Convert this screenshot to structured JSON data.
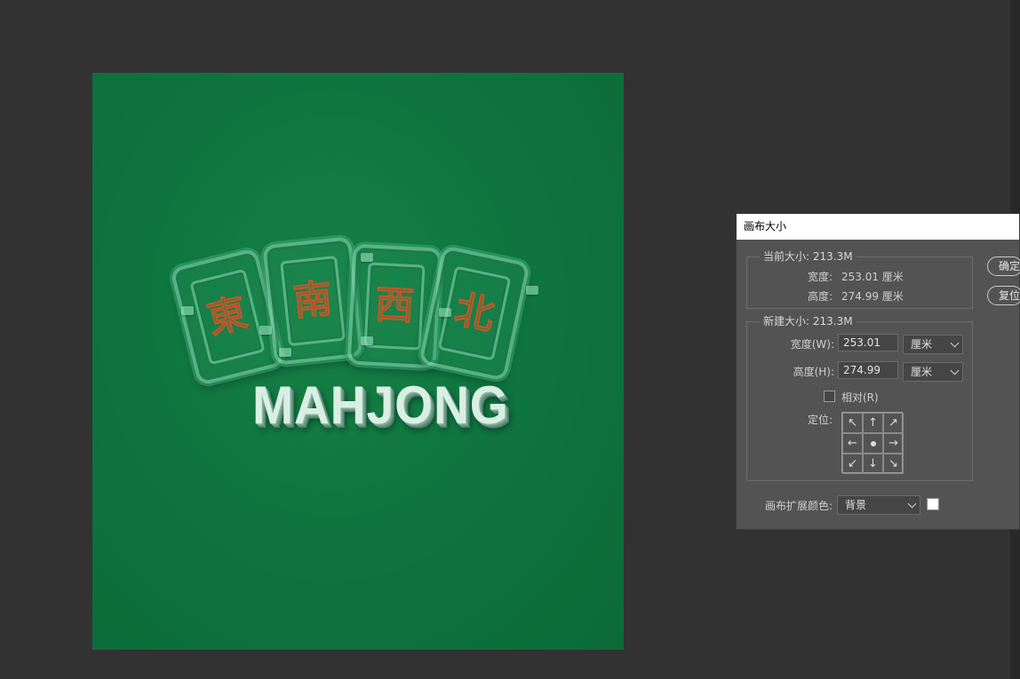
{
  "canvas": {
    "background_color": "#12773f",
    "artwork": {
      "tiles": [
        {
          "glyph": "東"
        },
        {
          "glyph": "南"
        },
        {
          "glyph": "西"
        },
        {
          "glyph": "北"
        }
      ],
      "title": "MAHJONG"
    }
  },
  "dialog": {
    "title": "画布大小",
    "current_size": {
      "legend": "当前大小: 213.3M",
      "width_label": "宽度:",
      "width_value": "253.01 厘米",
      "height_label": "高度:",
      "height_value": "274.99 厘米"
    },
    "new_size": {
      "legend": "新建大小: 213.3M",
      "width_label": "宽度(W):",
      "width_value": "253.01",
      "width_unit": "厘米",
      "height_label": "高度(H):",
      "height_value": "274.99",
      "height_unit": "厘米",
      "relative_label": "相对(R)",
      "relative_checked": false,
      "anchor_label": "定位:",
      "anchor_arrows": [
        "↖",
        "↑",
        "↗",
        "←",
        "",
        "→",
        "↙",
        "↓",
        "↘"
      ]
    },
    "extension_color": {
      "label": "画布扩展颜色:",
      "value": "背景",
      "swatch_color": "#ffffff"
    },
    "buttons": {
      "ok": "确定",
      "reset": "复位"
    }
  }
}
